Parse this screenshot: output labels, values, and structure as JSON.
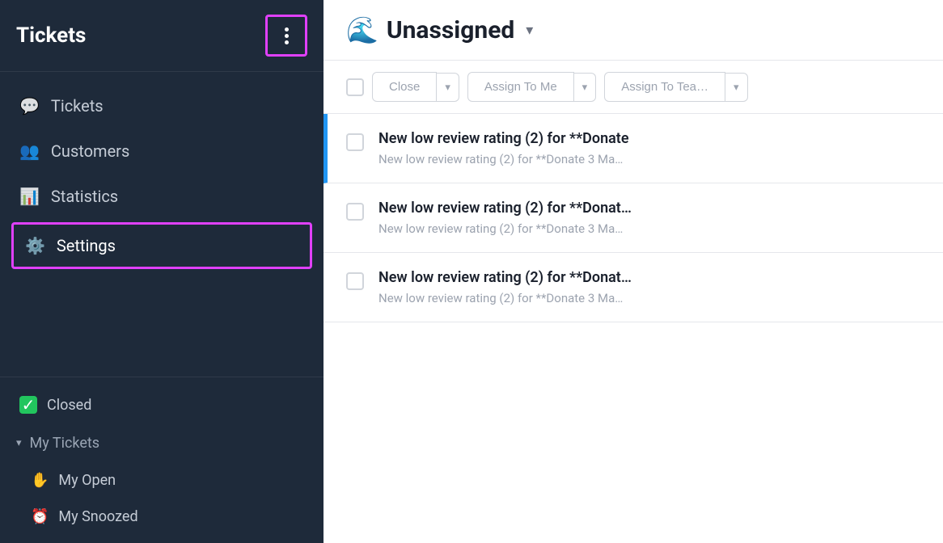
{
  "sidebar": {
    "title": "Tickets",
    "more_button_label": "⋮",
    "nav_items": [
      {
        "id": "tickets",
        "label": "Tickets",
        "icon": "💬"
      },
      {
        "id": "customers",
        "label": "Customers",
        "icon": "👥"
      },
      {
        "id": "statistics",
        "label": "Statistics",
        "icon": "📊"
      },
      {
        "id": "settings",
        "label": "Settings",
        "icon": "⚙️"
      }
    ],
    "section_items": [
      {
        "id": "closed",
        "label": "Closed",
        "icon": "✅",
        "icon_bg": "#22c55e"
      }
    ],
    "my_tickets": {
      "label": "My Tickets",
      "sub_items": [
        {
          "id": "my-open",
          "label": "My Open",
          "icon": "✋"
        },
        {
          "id": "my-snoozed",
          "label": "My Snoozed",
          "icon": "⏰"
        }
      ]
    }
  },
  "main": {
    "header": {
      "emoji": "🌊",
      "title": "Unassigned",
      "chevron": "▾"
    },
    "toolbar": {
      "close_label": "Close",
      "assign_to_me_label": "Assign To Me",
      "assign_to_team_label": "Assign To Tea…",
      "dropdown_icon": "▾"
    },
    "tickets": [
      {
        "id": 1,
        "active": true,
        "title": "New low review rating (2) for **Donate",
        "subtitle": "New low review rating (2) for **Donate 3 Ma…"
      },
      {
        "id": 2,
        "active": false,
        "title": "New low review rating (2) for **Donat…",
        "subtitle": "New low review rating (2) for **Donate 3 Ma…"
      },
      {
        "id": 3,
        "active": false,
        "title": "New low review rating (2) for **Donat…",
        "subtitle": "New low review rating (2) for **Donate 3 Ma…"
      }
    ]
  }
}
